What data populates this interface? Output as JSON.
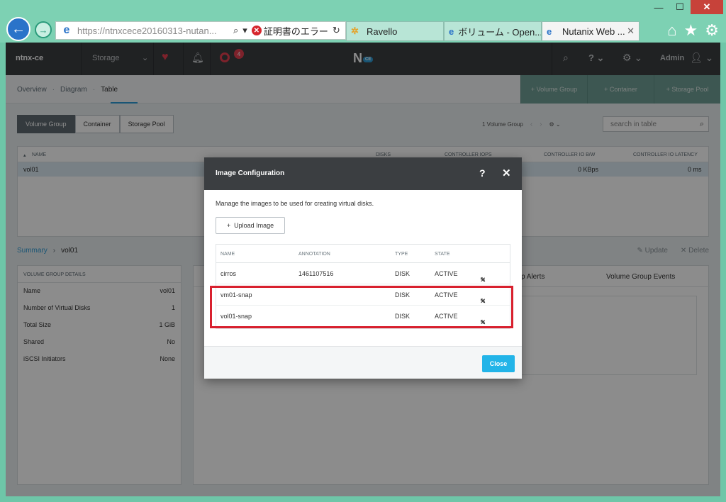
{
  "browser": {
    "url": "https://ntnxcece20160313-nutan...",
    "cert_error": "証明書のエラー",
    "tabs": [
      {
        "label": "Ravello",
        "icon": "ravello-icon"
      },
      {
        "label": "ボリューム - Open...",
        "icon": "ie-icon"
      },
      {
        "label": "Nutanix Web ...",
        "icon": "ie-icon",
        "active": true
      }
    ]
  },
  "header": {
    "cluster": "ntnx-ce",
    "section": "Storage",
    "alert_count": "4",
    "logo": "N",
    "logo_badge": "CE",
    "user": "Admin"
  },
  "subnav": {
    "links": [
      "Overview",
      "Diagram",
      "Table"
    ],
    "actions": [
      "+ Volume Group",
      "+ Container",
      "+ Storage Pool"
    ]
  },
  "view_tabs": [
    "Volume Group",
    "Container",
    "Storage Pool"
  ],
  "pager": {
    "count_text": "1 Volume Group"
  },
  "search": {
    "placeholder": "search in table"
  },
  "grid": {
    "columns": [
      "NAME",
      "DISKS",
      "CONTROLLER IOPS",
      "CONTROLLER IO B/W",
      "CONTROLLER IO LATENCY"
    ],
    "rows": [
      {
        "name": "vol01",
        "bw": "0 KBps",
        "latency": "0 ms"
      }
    ]
  },
  "summary": {
    "crumb": "Summary",
    "volume": "vol01",
    "update": "Update",
    "delete": "Delete"
  },
  "details": {
    "title": "VOLUME GROUP DETAILS",
    "rows": [
      {
        "label": "Name",
        "value": "vol01"
      },
      {
        "label": "Number of Virtual Disks",
        "value": "1"
      },
      {
        "label": "Total Size",
        "value": "1 GiB"
      },
      {
        "label": "Shared",
        "value": "No"
      },
      {
        "label": "iSCSI Initiators",
        "value": "None"
      }
    ]
  },
  "right_tabs": [
    "p Alerts",
    "Volume Group Events"
  ],
  "modal": {
    "title": "Image Configuration",
    "description": "Manage the images to be used for creating virtual disks.",
    "upload_label": "Upload Image",
    "columns": [
      "NAME",
      "ANNOTATION",
      "TYPE",
      "STATE"
    ],
    "images": [
      {
        "name": "cirros",
        "annotation": "1461107516",
        "type": "DISK",
        "state": "ACTIVE"
      },
      {
        "name": "vm01-snap",
        "annotation": "",
        "type": "DISK",
        "state": "ACTIVE"
      },
      {
        "name": "vol01-snap",
        "annotation": "",
        "type": "DISK",
        "state": "ACTIVE"
      }
    ],
    "close_label": "Close"
  },
  "colors": {
    "accent": "#2e9cd5",
    "highlight": "#d8202e",
    "close_button": "#22b4e8"
  }
}
